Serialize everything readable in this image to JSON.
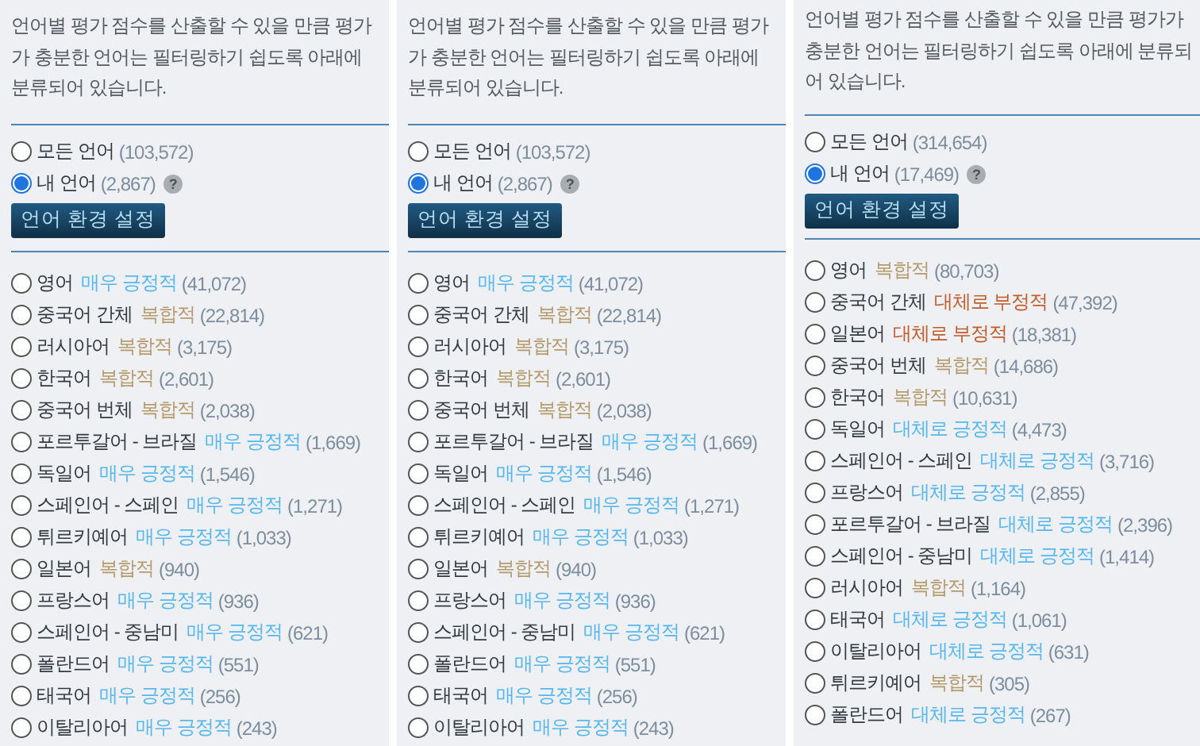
{
  "panels": [
    {
      "description": "언어별 평가 점수를 산출할 수 있을 만큼 평가가 충분한 언어는 필터링하기 쉽도록 아래에 분류되어 있습니다.",
      "scope_options": [
        {
          "label": "모든 언어",
          "count": "(103,572)",
          "selected": false
        },
        {
          "label": "내 언어",
          "count": "(2,867)",
          "selected": true,
          "help": "?"
        }
      ],
      "button": "언어 환경 설정",
      "languages": [
        {
          "name": "영어",
          "score": "매우 긍정적",
          "kind": "positive",
          "count": "(41,072)",
          "selected": false
        },
        {
          "name": "중국어 간체",
          "score": "복합적",
          "kind": "mixed",
          "count": "(22,814)",
          "selected": false
        },
        {
          "name": "러시아어",
          "score": "복합적",
          "kind": "mixed",
          "count": "(3,175)",
          "selected": false
        },
        {
          "name": "한국어",
          "score": "복합적",
          "kind": "mixed",
          "count": "(2,601)",
          "selected": false
        },
        {
          "name": "중국어 번체",
          "score": "복합적",
          "kind": "mixed",
          "count": "(2,038)",
          "selected": false
        },
        {
          "name": "포르투갈어 - 브라질",
          "score": "매우 긍정적",
          "kind": "positive",
          "count": "(1,669)",
          "selected": false
        },
        {
          "name": "독일어",
          "score": "매우 긍정적",
          "kind": "positive",
          "count": "(1,546)",
          "selected": false
        },
        {
          "name": "스페인어 - 스페인",
          "score": "매우 긍정적",
          "kind": "positive",
          "count": "(1,271)",
          "selected": false
        },
        {
          "name": "튀르키예어",
          "score": "매우 긍정적",
          "kind": "positive",
          "count": "(1,033)",
          "selected": false
        },
        {
          "name": "일본어",
          "score": "복합적",
          "kind": "mixed",
          "count": "(940)",
          "selected": false
        },
        {
          "name": "프랑스어",
          "score": "매우 긍정적",
          "kind": "positive",
          "count": "(936)",
          "selected": false
        },
        {
          "name": "스페인어 - 중남미",
          "score": "매우 긍정적",
          "kind": "positive",
          "count": "(621)",
          "selected": false
        },
        {
          "name": "폴란드어",
          "score": "매우 긍정적",
          "kind": "positive",
          "count": "(551)",
          "selected": false
        },
        {
          "name": "태국어",
          "score": "매우 긍정적",
          "kind": "positive",
          "count": "(256)",
          "selected": false
        },
        {
          "name": "이탈리아어",
          "score": "매우 긍정적",
          "kind": "positive",
          "count": "(243)",
          "selected": false
        }
      ]
    },
    {
      "description": "언어별 평가 점수를 산출할 수 있을 만큼 평가가 충분한 언어는 필터링하기 쉽도록 아래에 분류되어 있습니다.",
      "scope_options": [
        {
          "label": "모든 언어",
          "count": "(103,572)",
          "selected": false
        },
        {
          "label": "내 언어",
          "count": "(2,867)",
          "selected": true,
          "help": "?"
        }
      ],
      "button": "언어 환경 설정",
      "languages": [
        {
          "name": "영어",
          "score": "매우 긍정적",
          "kind": "positive",
          "count": "(41,072)",
          "selected": false
        },
        {
          "name": "중국어 간체",
          "score": "복합적",
          "kind": "mixed",
          "count": "(22,814)",
          "selected": false
        },
        {
          "name": "러시아어",
          "score": "복합적",
          "kind": "mixed",
          "count": "(3,175)",
          "selected": false
        },
        {
          "name": "한국어",
          "score": "복합적",
          "kind": "mixed",
          "count": "(2,601)",
          "selected": false
        },
        {
          "name": "중국어 번체",
          "score": "복합적",
          "kind": "mixed",
          "count": "(2,038)",
          "selected": false
        },
        {
          "name": "포르투갈어 - 브라질",
          "score": "매우 긍정적",
          "kind": "positive",
          "count": "(1,669)",
          "selected": false
        },
        {
          "name": "독일어",
          "score": "매우 긍정적",
          "kind": "positive",
          "count": "(1,546)",
          "selected": false
        },
        {
          "name": "스페인어 - 스페인",
          "score": "매우 긍정적",
          "kind": "positive",
          "count": "(1,271)",
          "selected": false
        },
        {
          "name": "튀르키예어",
          "score": "매우 긍정적",
          "kind": "positive",
          "count": "(1,033)",
          "selected": false
        },
        {
          "name": "일본어",
          "score": "복합적",
          "kind": "mixed",
          "count": "(940)",
          "selected": false
        },
        {
          "name": "프랑스어",
          "score": "매우 긍정적",
          "kind": "positive",
          "count": "(936)",
          "selected": false
        },
        {
          "name": "스페인어 - 중남미",
          "score": "매우 긍정적",
          "kind": "positive",
          "count": "(621)",
          "selected": false
        },
        {
          "name": "폴란드어",
          "score": "매우 긍정적",
          "kind": "positive",
          "count": "(551)",
          "selected": false
        },
        {
          "name": "태국어",
          "score": "매우 긍정적",
          "kind": "positive",
          "count": "(256)",
          "selected": false
        },
        {
          "name": "이탈리아어",
          "score": "매우 긍정적",
          "kind": "positive",
          "count": "(243)",
          "selected": false
        }
      ]
    },
    {
      "description": "언어별 평가 점수를 산출할 수 있을 만큼 평가가 충분한 언어는 필터링하기 쉽도록 아래에 분류되어 있습니다.",
      "scope_options": [
        {
          "label": "모든 언어",
          "count": "(314,654)",
          "selected": false
        },
        {
          "label": "내 언어",
          "count": "(17,469)",
          "selected": true,
          "help": "?"
        }
      ],
      "button": "언어 환경 설정",
      "languages": [
        {
          "name": "영어",
          "score": "복합적",
          "kind": "mixed",
          "count": "(80,703)",
          "selected": false
        },
        {
          "name": "중국어 간체",
          "score": "대체로 부정적",
          "kind": "negative",
          "count": "(47,392)",
          "selected": false
        },
        {
          "name": "일본어",
          "score": "대체로 부정적",
          "kind": "negative",
          "count": "(18,381)",
          "selected": false
        },
        {
          "name": "중국어 번체",
          "score": "복합적",
          "kind": "mixed",
          "count": "(14,686)",
          "selected": false
        },
        {
          "name": "한국어",
          "score": "복합적",
          "kind": "mixed",
          "count": "(10,631)",
          "selected": false
        },
        {
          "name": "독일어",
          "score": "대체로 긍정적",
          "kind": "positive",
          "count": "(4,473)",
          "selected": false
        },
        {
          "name": "스페인어 - 스페인",
          "score": "대체로 긍정적",
          "kind": "positive",
          "count": "(3,716)",
          "selected": false
        },
        {
          "name": "프랑스어",
          "score": "대체로 긍정적",
          "kind": "positive",
          "count": "(2,855)",
          "selected": false
        },
        {
          "name": "포르투갈어 - 브라질",
          "score": "대체로 긍정적",
          "kind": "positive",
          "count": "(2,396)",
          "selected": false
        },
        {
          "name": "스페인어 - 중남미",
          "score": "대체로 긍정적",
          "kind": "positive",
          "count": "(1,414)",
          "selected": false
        },
        {
          "name": "러시아어",
          "score": "복합적",
          "kind": "mixed",
          "count": "(1,164)",
          "selected": false
        },
        {
          "name": "태국어",
          "score": "대체로 긍정적",
          "kind": "positive",
          "count": "(1,061)",
          "selected": false
        },
        {
          "name": "이탈리아어",
          "score": "대체로 긍정적",
          "kind": "positive",
          "count": "(631)",
          "selected": false
        },
        {
          "name": "튀르키예어",
          "score": "복합적",
          "kind": "mixed",
          "count": "(305)",
          "selected": false
        },
        {
          "name": "폴란드어",
          "score": "대체로 긍정적",
          "kind": "positive",
          "count": "(267)",
          "selected": false
        }
      ]
    }
  ]
}
